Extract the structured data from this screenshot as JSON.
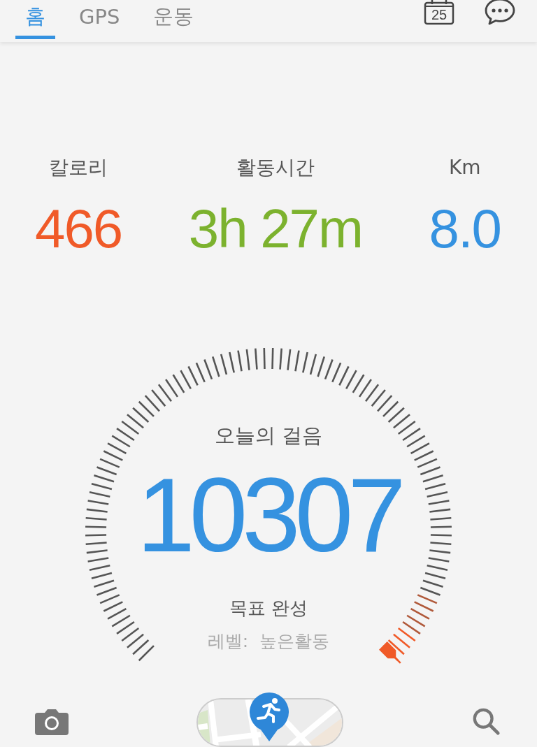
{
  "tabs": [
    {
      "label": "홈",
      "selected": true
    },
    {
      "label": "GPS",
      "selected": false
    },
    {
      "label": "운동",
      "selected": false
    }
  ],
  "calendar": {
    "day": "25"
  },
  "stats": [
    {
      "label": "칼로리",
      "value": "466",
      "color": "#f05a28"
    },
    {
      "label": "활동시간",
      "value": "3h 27m",
      "color": "#7cb22e"
    },
    {
      "label": "Km",
      "value": "8.0",
      "color": "#3592e0"
    }
  ],
  "gauge": {
    "title": "오늘의 걸음",
    "steps": "10307",
    "status": "목표 완성",
    "level_text": "레벨:  높은활동"
  }
}
